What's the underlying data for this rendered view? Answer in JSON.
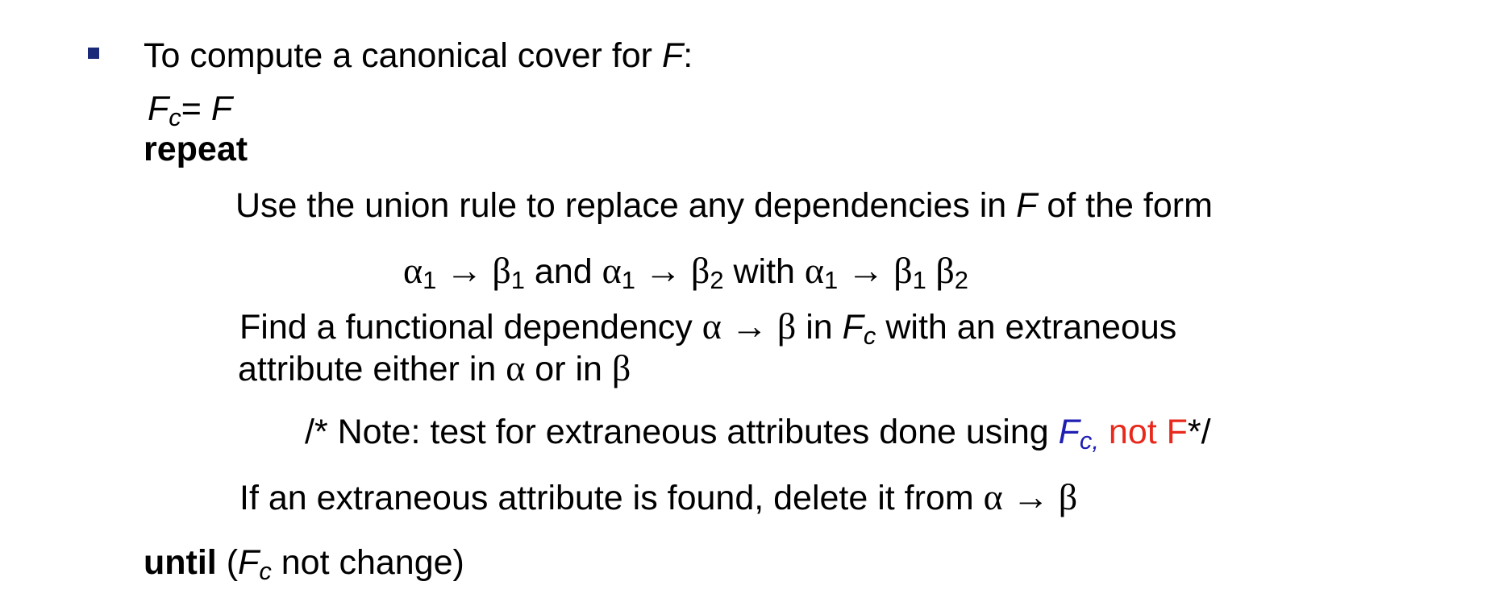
{
  "line1": {
    "text": "To compute a canonical cover for ",
    "var": "F",
    "colon": ":"
  },
  "init": {
    "lhs_var": "F",
    "lhs_sub": "c",
    "eq": "= ",
    "rhs_var": "F"
  },
  "repeat_kw": "repeat",
  "union_line": {
    "text1": "Use the union rule to replace any dependencies in ",
    "var": "F",
    "text2": " of the form"
  },
  "union_formula": {
    "a1": "α",
    "a1_sub": "1",
    "arrow1": " → ",
    "b1": "β",
    "b1_sub": "1",
    "and": " and ",
    "a2": "α",
    "a2_sub": "1",
    "arrow2": " → ",
    "b2": "β",
    "b2_sub": "2",
    "with": " with ",
    "a3": "α",
    "a3_sub": "1",
    "arrow3": " → ",
    "b3": "β",
    "b3_sub": "1",
    "b4": " β",
    "b4_sub": "2"
  },
  "find_line": {
    "text1": "Find a functional dependency ",
    "alpha": "α",
    "arrow": " → ",
    "beta": "β",
    "text2": "  in ",
    "fc_var": "F",
    "fc_sub": "c",
    "text3": " with an extraneous"
  },
  "attr_line": {
    "text1": "attribute either in ",
    "alpha": "α",
    "text2": " or in ",
    "beta": "β"
  },
  "note_line": {
    "text1": "/* Note: test for extraneous attributes done using ",
    "fc_var": "F",
    "fc_sub": "c,",
    "not_f": " not F",
    "end": "*/"
  },
  "delete_line": {
    "text1": "If an extraneous attribute is found, delete it from ",
    "alpha": "α",
    "arrow": " → ",
    "beta": "β"
  },
  "until_line": {
    "kw": "until",
    "paren_open": "  (",
    "fc_var": "F",
    "fc_sub": "c",
    "text": " not change)"
  }
}
